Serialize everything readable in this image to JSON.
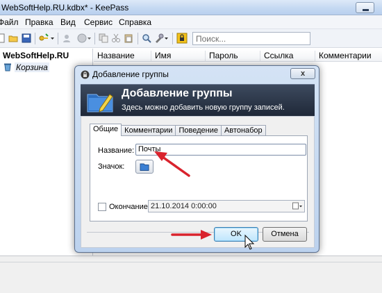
{
  "window": {
    "title": "WebSoftHelp.RU.kdbx* - KeePass"
  },
  "menu": [
    "Файл",
    "Правка",
    "Вид",
    "Сервис",
    "Справка"
  ],
  "toolbar": {
    "search_placeholder": "Поиск..."
  },
  "tree": {
    "root": "WebSoftHelp.RU",
    "recycle_bin": "Корзина"
  },
  "list": {
    "columns": [
      "Название",
      "Имя",
      "Пароль",
      "Ссылка",
      "Комментарии"
    ]
  },
  "dialog": {
    "title": "Добавление группы",
    "banner_title": "Добавление группы",
    "banner_subtitle": "Здесь можно добавить новую группу записей.",
    "close_glyph": "x",
    "tabs": [
      "Общие",
      "Комментарии",
      "Поведение",
      "Автонабор"
    ],
    "active_tab": "Общие",
    "name_label": "Название:",
    "name_value": "Почты",
    "icon_label": "Значок:",
    "expires_label": "Окончание:",
    "expires_checked": false,
    "expires_value": "21.10.2014   0:00:00",
    "ok_label": "OK",
    "cancel_label": "Отмена"
  },
  "colors": {
    "annotation_arrow": "#d9232d",
    "banner_dark": "#1f2838"
  }
}
